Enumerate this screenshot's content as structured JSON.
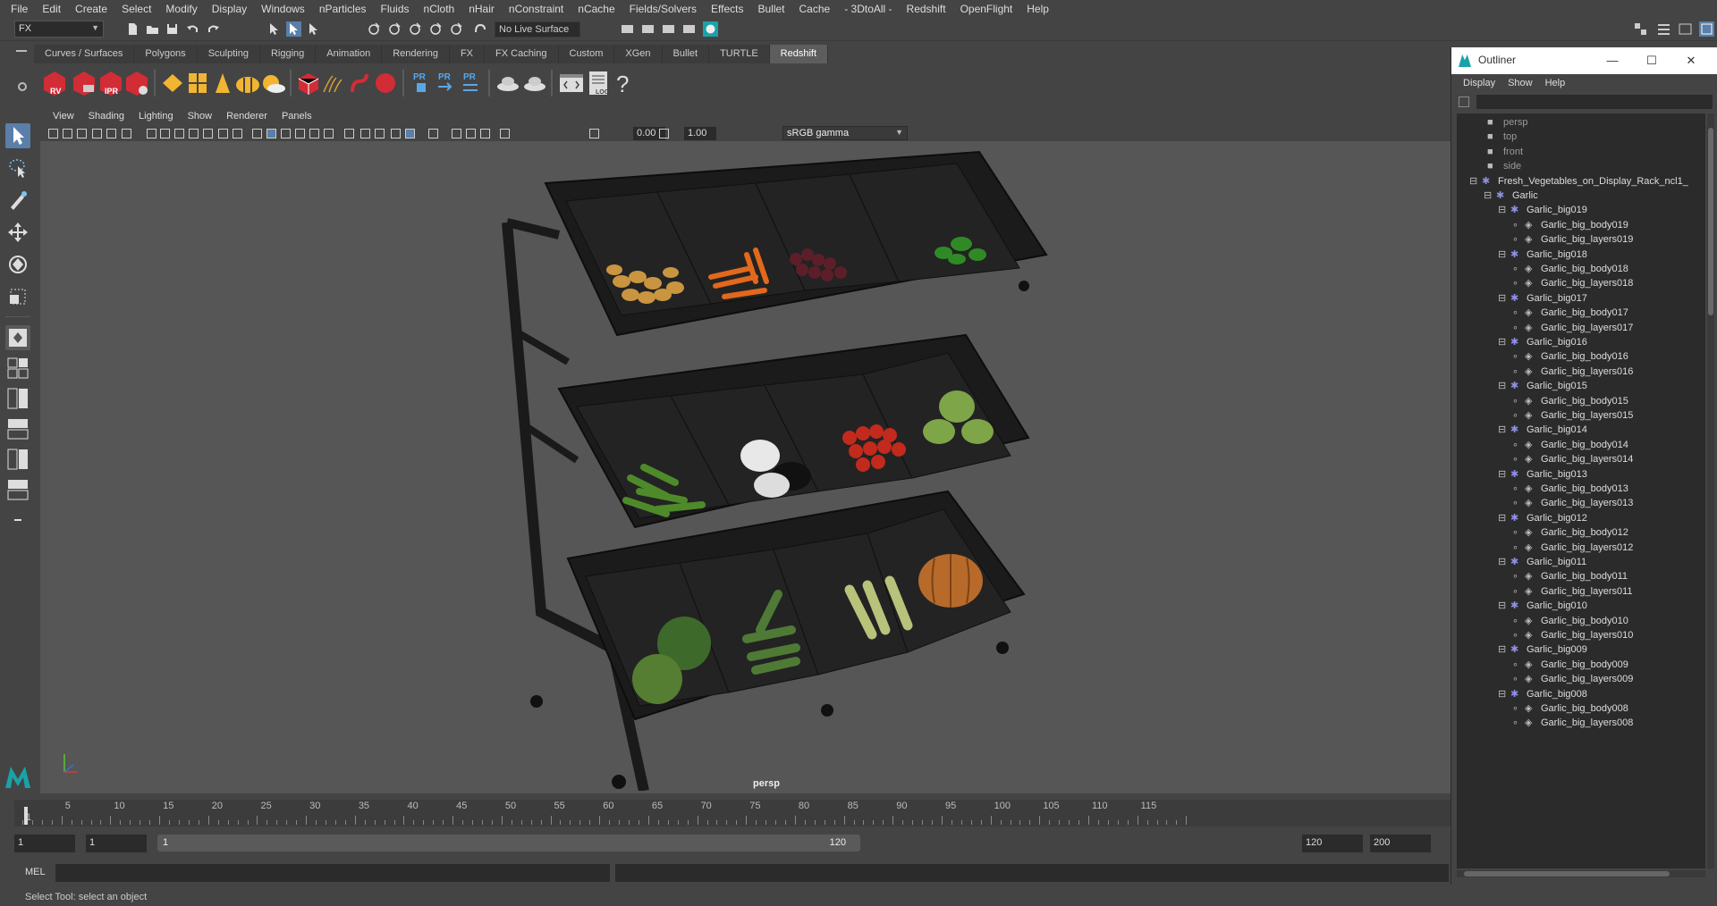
{
  "menubar": [
    "File",
    "Edit",
    "Create",
    "Select",
    "Modify",
    "Display",
    "Windows",
    "nParticles",
    "Fluids",
    "nCloth",
    "nHair",
    "nConstraint",
    "nCache",
    "Fields/Solvers",
    "Effects",
    "Bullet",
    "Cache",
    "- 3DtoAll -",
    "Redshift",
    "OpenFlight",
    "Help"
  ],
  "statusline": {
    "mode": "FX",
    "live_surface": "No Live Surface"
  },
  "shelf": {
    "tabs": [
      "Curves / Surfaces",
      "Polygons",
      "Sculpting",
      "Rigging",
      "Animation",
      "Rendering",
      "FX",
      "FX Caching",
      "Custom",
      "XGen",
      "Bullet",
      "TURTLE",
      "Redshift"
    ],
    "active_tab": "Redshift",
    "icon_labels": {
      "rv": "RV",
      "ipr": "IPR",
      "pr": "PR",
      "log": "LOG"
    }
  },
  "viewport": {
    "menu": [
      "View",
      "Shading",
      "Lighting",
      "Show",
      "Renderer",
      "Panels"
    ],
    "exposure": "0.00",
    "gamma": "1.00",
    "color_space": "sRGB gamma",
    "camera": "persp"
  },
  "outliner": {
    "title": "Outliner",
    "menu": [
      "Display",
      "Show",
      "Help"
    ],
    "cameras": [
      "persp",
      "top",
      "front",
      "side"
    ],
    "root": "Fresh_Vegetables_on_Display_Rack_ncl1_",
    "group": "Garlic",
    "items": [
      {
        "name": "Garlic_big019",
        "body": "Garlic_big_body019",
        "layers": "Garlic_big_layers019"
      },
      {
        "name": "Garlic_big018",
        "body": "Garlic_big_body018",
        "layers": "Garlic_big_layers018"
      },
      {
        "name": "Garlic_big017",
        "body": "Garlic_big_body017",
        "layers": "Garlic_big_layers017"
      },
      {
        "name": "Garlic_big016",
        "body": "Garlic_big_body016",
        "layers": "Garlic_big_layers016"
      },
      {
        "name": "Garlic_big015",
        "body": "Garlic_big_body015",
        "layers": "Garlic_big_layers015"
      },
      {
        "name": "Garlic_big014",
        "body": "Garlic_big_body014",
        "layers": "Garlic_big_layers014"
      },
      {
        "name": "Garlic_big013",
        "body": "Garlic_big_body013",
        "layers": "Garlic_big_layers013"
      },
      {
        "name": "Garlic_big012",
        "body": "Garlic_big_body012",
        "layers": "Garlic_big_layers012"
      },
      {
        "name": "Garlic_big011",
        "body": "Garlic_big_body011",
        "layers": "Garlic_big_layers011"
      },
      {
        "name": "Garlic_big010",
        "body": "Garlic_big_body010",
        "layers": "Garlic_big_layers010"
      },
      {
        "name": "Garlic_big009",
        "body": "Garlic_big_body009",
        "layers": "Garlic_big_layers009"
      },
      {
        "name": "Garlic_big008",
        "body": "Garlic_big_body008",
        "layers": "Garlic_big_layers008"
      }
    ]
  },
  "timeline": {
    "ticks": [
      "1",
      "5",
      "10",
      "15",
      "20",
      "25",
      "30",
      "35",
      "40",
      "45",
      "50",
      "55",
      "60",
      "65",
      "70",
      "75",
      "80",
      "85",
      "90",
      "95",
      "100",
      "105",
      "110",
      "115"
    ],
    "start_frame": "1",
    "current_frame": "1",
    "range_start": "1",
    "range_end": "120",
    "end_frame": "120",
    "max_frame": "200"
  },
  "command_line": {
    "label": "MEL"
  },
  "status": "Select Tool: select an object",
  "colors": {
    "accent": "#5a7fa8",
    "active_tab": "#5d5d5d",
    "redshift_red": "#d22c36",
    "maya_teal": "#19a3a8",
    "transform_icon": "#8f8fe6"
  }
}
